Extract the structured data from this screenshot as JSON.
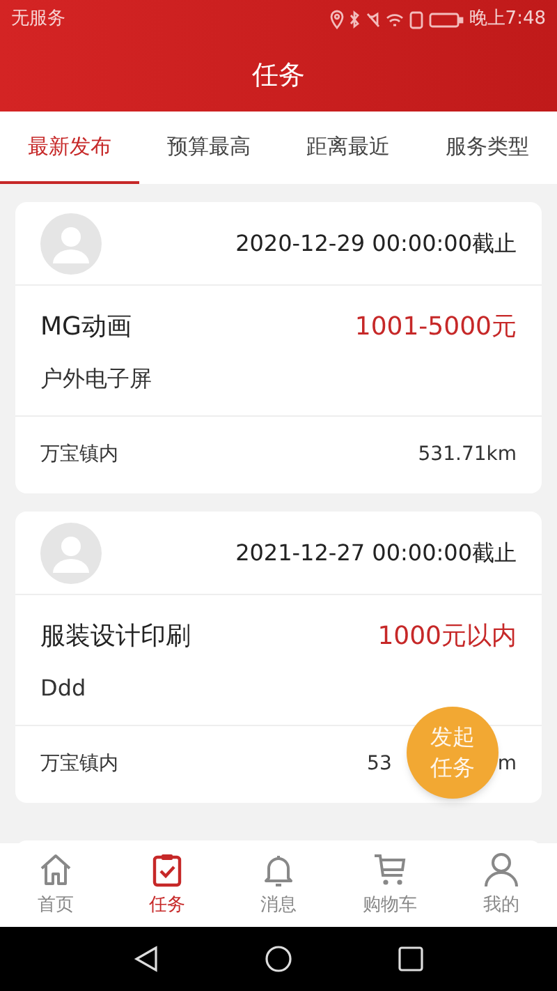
{
  "status_bar": {
    "carrier": "无服务",
    "time": "晚上7:48"
  },
  "title": "任务",
  "tabs": [
    {
      "label": "最新发布",
      "selected": true
    },
    {
      "label": "预算最高",
      "selected": false
    },
    {
      "label": "距离最近",
      "selected": false
    },
    {
      "label": "服务类型",
      "selected": false
    }
  ],
  "tasks": [
    {
      "deadline": "2020-12-29 00:00:00截止",
      "name": "MG动画",
      "budget": "1001-5000元",
      "category": "户外电子屏",
      "location": "万宝镇内",
      "distance": "531.71km"
    },
    {
      "deadline": "2021-12-27 00:00:00截止",
      "name": "服装设计印刷",
      "budget": "1000元以内",
      "category": "Ddd",
      "location": "万宝镇内",
      "distance": "53",
      "distance_tail": "m"
    }
  ],
  "fab": {
    "label": "发起任务"
  },
  "bottom_nav": [
    {
      "label": "首页",
      "selected": false
    },
    {
      "label": "任务",
      "selected": true
    },
    {
      "label": "消息",
      "selected": false
    },
    {
      "label": "购物车",
      "selected": false
    },
    {
      "label": "我的",
      "selected": false
    }
  ]
}
